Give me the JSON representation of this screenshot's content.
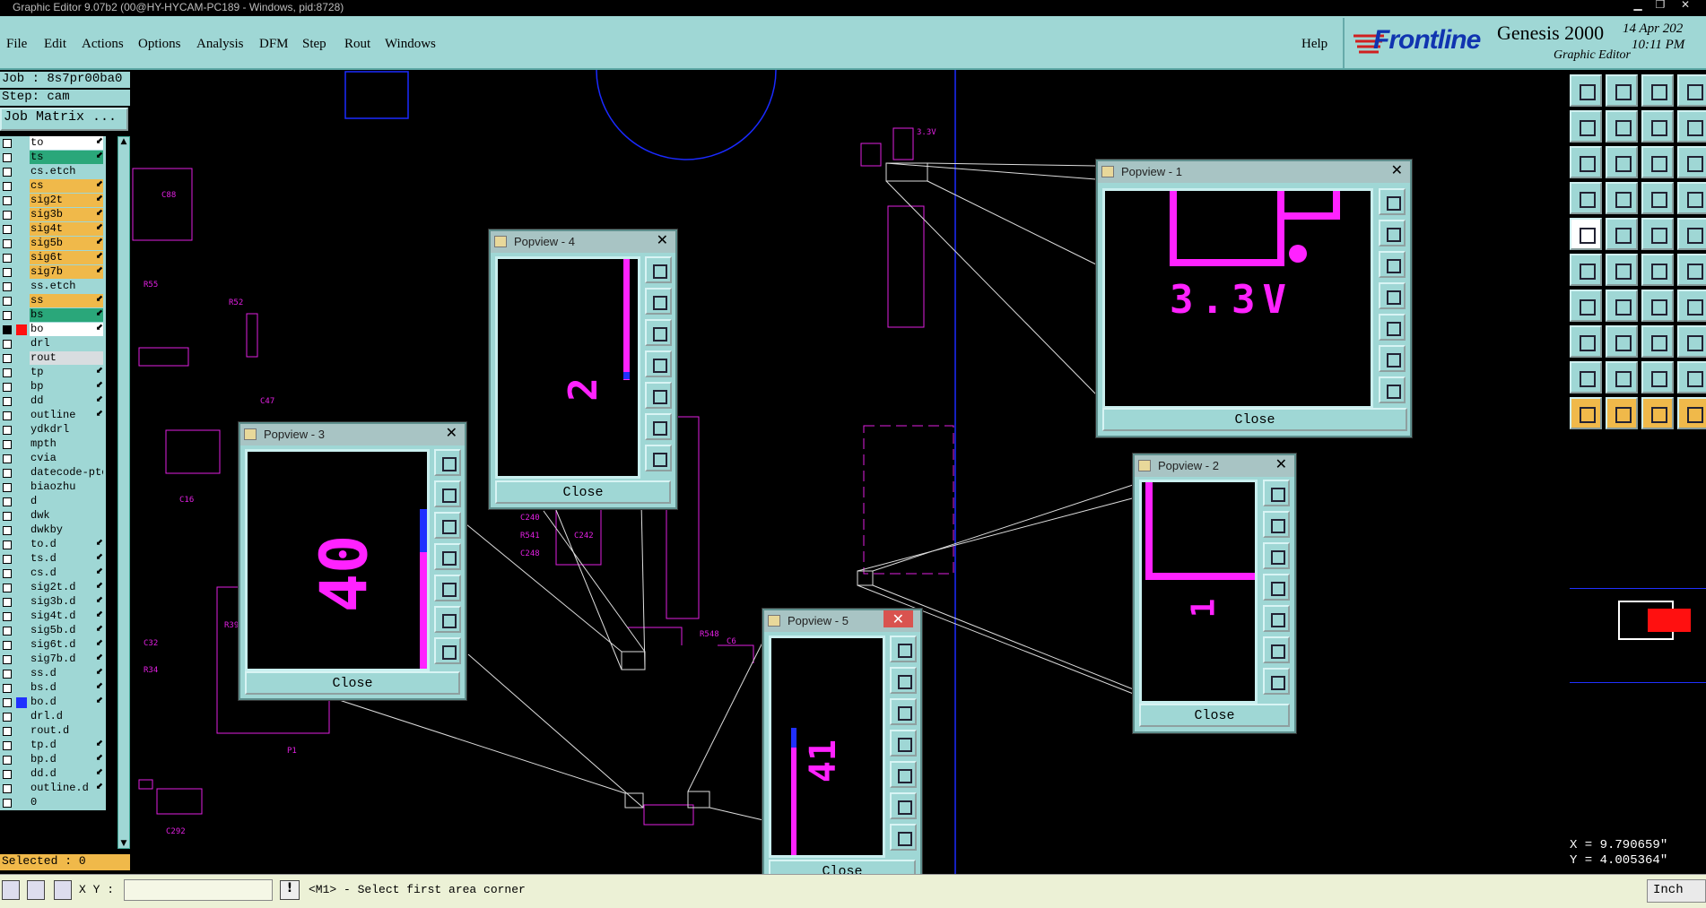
{
  "window": {
    "title": "Graphic Editor 9.07b2 (00@HY-HYCAM-PC189 - Windows, pid:8728)"
  },
  "menu": [
    "File",
    "Edit",
    "Actions",
    "Options",
    "Analysis",
    "DFM",
    "Step",
    "Rout",
    "Windows"
  ],
  "help": "Help",
  "brand": {
    "logo": "Frontline",
    "product": "Genesis 2000",
    "subtitle": "Graphic Editor",
    "date": "14 Apr 202",
    "time": "10:11 PM"
  },
  "job": {
    "job": "Job : 8s7pr00ba0",
    "step": "Step: cam",
    "matrix_button": "Job Matrix ..."
  },
  "layers": [
    {
      "name": "to",
      "color": "#ffffff",
      "arrow": true
    },
    {
      "name": "ts",
      "color": "#2aa77a",
      "arrow": true
    },
    {
      "name": "cs.etch",
      "color": "#9fd7d5",
      "arrow": false
    },
    {
      "name": "cs",
      "color": "#f0b94a",
      "arrow": true
    },
    {
      "name": "sig2t",
      "color": "#f0b94a",
      "arrow": true
    },
    {
      "name": "sig3b",
      "color": "#f0b94a",
      "arrow": true
    },
    {
      "name": "sig4t",
      "color": "#f0b94a",
      "arrow": true
    },
    {
      "name": "sig5b",
      "color": "#f0b94a",
      "arrow": true
    },
    {
      "name": "sig6t",
      "color": "#f0b94a",
      "arrow": true
    },
    {
      "name": "sig7b",
      "color": "#f0b94a",
      "arrow": true
    },
    {
      "name": "ss.etch",
      "color": "#9fd7d5",
      "arrow": false
    },
    {
      "name": "ss",
      "color": "#f0b94a",
      "arrow": true
    },
    {
      "name": "bs",
      "color": "#2aa77a",
      "arrow": true
    },
    {
      "name": "bo",
      "color": "#ffffff",
      "arrow": true
    },
    {
      "name": "drl",
      "color": "#9fd7d5",
      "arrow": false
    },
    {
      "name": "rout",
      "color": "#d8dde0",
      "arrow": false
    },
    {
      "name": "tp",
      "color": "#9fd7d5",
      "arrow": true
    },
    {
      "name": "bp",
      "color": "#9fd7d5",
      "arrow": true
    },
    {
      "name": "dd",
      "color": "#9fd7d5",
      "arrow": true
    },
    {
      "name": "outline",
      "color": "#9fd7d5",
      "arrow": true
    },
    {
      "name": "ydkdrl",
      "color": "#9fd7d5",
      "arrow": false
    },
    {
      "name": "mpth",
      "color": "#9fd7d5",
      "arrow": false
    },
    {
      "name": "cvia",
      "color": "#9fd7d5",
      "arrow": false
    },
    {
      "name": "datecode-ptc",
      "color": "#9fd7d5",
      "arrow": false
    },
    {
      "name": "biaozhu",
      "color": "#9fd7d5",
      "arrow": false
    },
    {
      "name": "d",
      "color": "#9fd7d5",
      "arrow": false
    },
    {
      "name": "dwk",
      "color": "#9fd7d5",
      "arrow": false
    },
    {
      "name": "dwkby",
      "color": "#9fd7d5",
      "arrow": false
    },
    {
      "name": "to.d",
      "color": "#9fd7d5",
      "arrow": true
    },
    {
      "name": "ts.d",
      "color": "#9fd7d5",
      "arrow": true
    },
    {
      "name": "cs.d",
      "color": "#9fd7d5",
      "arrow": true
    },
    {
      "name": "sig2t.d",
      "color": "#9fd7d5",
      "arrow": true
    },
    {
      "name": "sig3b.d",
      "color": "#9fd7d5",
      "arrow": true
    },
    {
      "name": "sig4t.d",
      "color": "#9fd7d5",
      "arrow": true
    },
    {
      "name": "sig5b.d",
      "color": "#9fd7d5",
      "arrow": true
    },
    {
      "name": "sig6t.d",
      "color": "#9fd7d5",
      "arrow": true
    },
    {
      "name": "sig7b.d",
      "color": "#9fd7d5",
      "arrow": true
    },
    {
      "name": "ss.d",
      "color": "#9fd7d5",
      "arrow": true
    },
    {
      "name": "bs.d",
      "color": "#9fd7d5",
      "arrow": true
    },
    {
      "name": "bo.d",
      "color": "#9fd7d5",
      "arrow": true
    },
    {
      "name": "drl.d",
      "color": "#9fd7d5",
      "arrow": false
    },
    {
      "name": "rout.d",
      "color": "#9fd7d5",
      "arrow": false
    },
    {
      "name": "tp.d",
      "color": "#9fd7d5",
      "arrow": true
    },
    {
      "name": "bp.d",
      "color": "#9fd7d5",
      "arrow": true
    },
    {
      "name": "dd.d",
      "color": "#9fd7d5",
      "arrow": true
    },
    {
      "name": "outline.d",
      "color": "#9fd7d5",
      "arrow": true
    },
    {
      "name": "0",
      "color": "#9fd7d5",
      "arrow": false
    }
  ],
  "selected": "Selected : 0",
  "popviews": [
    {
      "title": "Popview - 1",
      "close": "Close",
      "label": "3.3V"
    },
    {
      "title": "Popview - 2",
      "close": "Close",
      "label": "1"
    },
    {
      "title": "Popview - 3",
      "close": "Close",
      "label": "40"
    },
    {
      "title": "Popview - 4",
      "close": "Close",
      "label": "2"
    },
    {
      "title": "Popview - 5",
      "close": "Close",
      "label": "41"
    }
  ],
  "coords": {
    "x": "X = 9.790659\"",
    "y": "Y = 4.005364\""
  },
  "status": {
    "xy_label": "X Y :",
    "xy_value": "",
    "prompt": "<M1> - Select first area corner",
    "units": "Inch"
  },
  "canvas_labels": [
    "3.3V"
  ],
  "colors": {
    "panel": "#9fd7d5",
    "orange": "#f0b94a",
    "magenta": "#ff22ff",
    "blue": "#1a2aff"
  }
}
